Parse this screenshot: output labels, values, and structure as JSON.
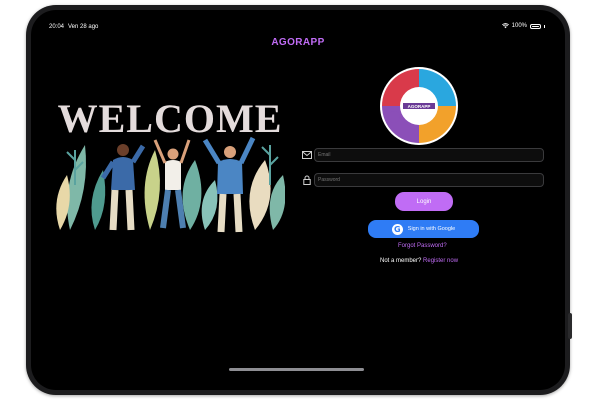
{
  "status_bar": {
    "time": "20:04",
    "date": "Ven 28 ago",
    "battery": "100%"
  },
  "app": {
    "title": "AGORAPP"
  },
  "hero": {
    "welcome_text": "WELCOME"
  },
  "logo": {
    "text": "AGORAPP"
  },
  "form": {
    "email_placeholder": "Email",
    "password_placeholder": "Password",
    "login_label": "Login",
    "google_label": "Sign in with Google",
    "forgot_label": "Forgot Password?",
    "register_prompt": "Not a member?",
    "register_link": "Register now"
  },
  "colors": {
    "accent": "#c06cf5",
    "google_blue": "#2f7cf5",
    "background": "#000000"
  },
  "icons": [
    "wifi-icon",
    "battery-icon",
    "mail-icon",
    "lock-icon",
    "google-icon"
  ]
}
